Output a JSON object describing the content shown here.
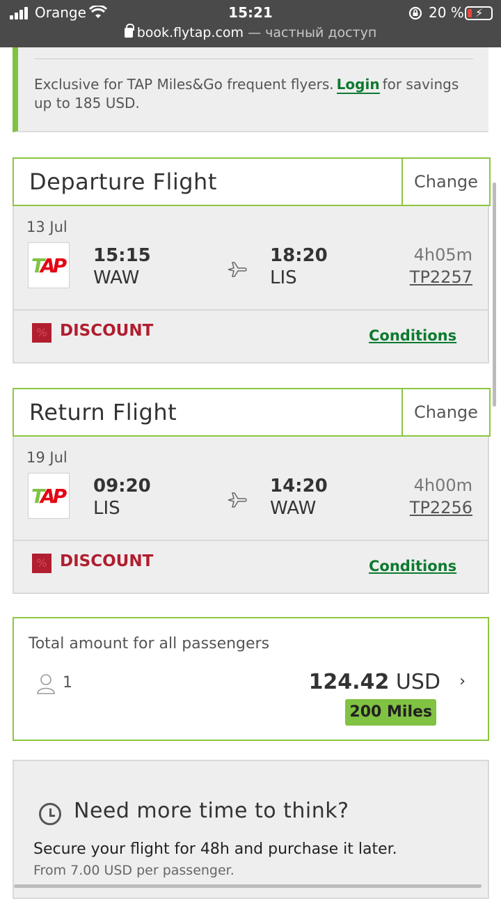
{
  "status": {
    "carrier": "Orange",
    "time": "15:21",
    "battery": "20 %",
    "url_host": "book.flytap.com",
    "url_note": " — частный доступ"
  },
  "promo": {
    "text_before": "Exclusive for TAP Miles&Go frequent flyers.",
    "login": "Login",
    "text_after": "for savings up to 185 USD."
  },
  "departure": {
    "title": "Departure Flight",
    "change": "Change",
    "date": "13 Jul",
    "dep_time": "15:15",
    "dep_code": "WAW",
    "arr_time": "18:20",
    "arr_code": "LIS",
    "duration": "4h05m",
    "flight_no": "TP2257",
    "fare": "DISCOUNT",
    "conditions": "Conditions",
    "logo": "TAP"
  },
  "return": {
    "title": "Return Flight",
    "change": "Change",
    "date": "19 Jul",
    "dep_time": "09:20",
    "dep_code": "LIS",
    "arr_time": "14:20",
    "arr_code": "WAW",
    "duration": "4h00m",
    "flight_no": "TP2256",
    "fare": "DISCOUNT",
    "conditions": "Conditions",
    "logo": "TAP"
  },
  "total": {
    "label": "Total amount for all passengers",
    "passengers": "1",
    "amount": "124.42",
    "currency": "USD",
    "miles": "200 Miles"
  },
  "hold": {
    "heading": "Need more time to think?",
    "line1": "Secure your flight for 48h and purchase it later.",
    "line2": "From 7.00 USD per passenger."
  },
  "colors": {
    "accent_green": "#80c242",
    "link_green": "#0e7a30",
    "discount_red": "#b01e2f"
  }
}
